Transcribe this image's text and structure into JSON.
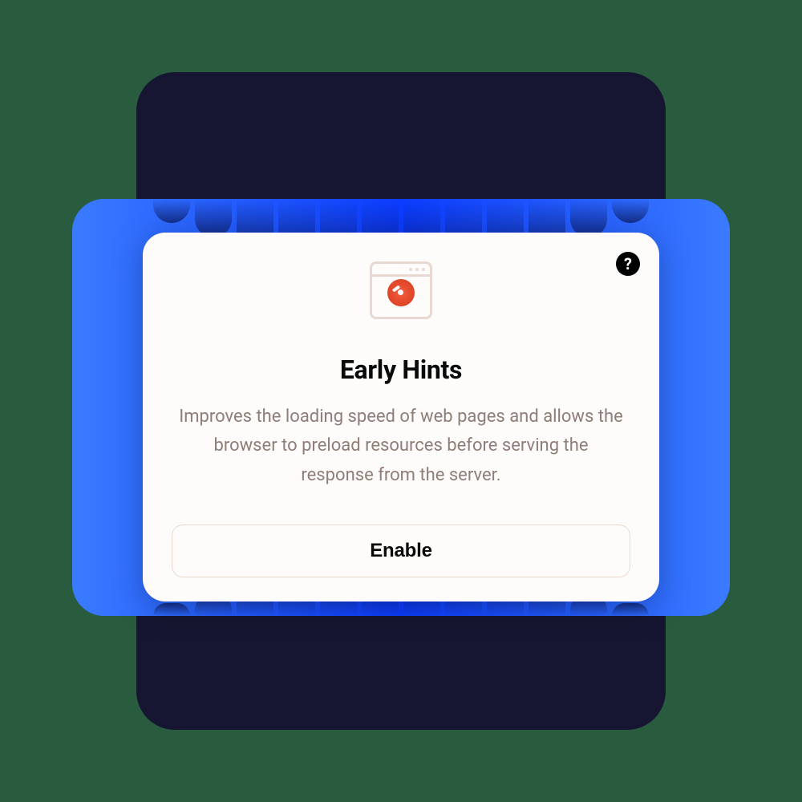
{
  "card": {
    "icon_name": "speed-gauge-window-icon",
    "title": "Early Hints",
    "description": "Improves the loading speed of web pages and allows the browser to preload resources before serving the response from the server.",
    "button_label": "Enable",
    "help_label": "?"
  }
}
